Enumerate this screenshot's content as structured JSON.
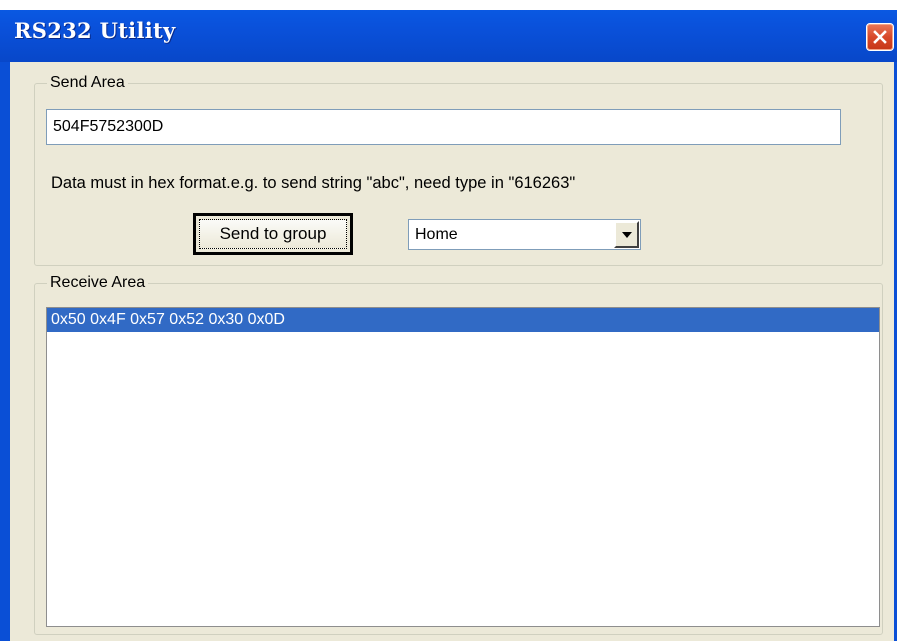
{
  "window": {
    "title": "RS232 Utility"
  },
  "send_area": {
    "legend": "Send Area",
    "hex_value": "504F5752300D",
    "hint": "Data must in hex format.e.g. to send string \"abc\", need type in \"616263\"",
    "send_button_label": "Send to group",
    "group_selected": "Home"
  },
  "receive_area": {
    "legend": "Receive Area",
    "rows": [
      {
        "text": "0x50 0x4F 0x57 0x52 0x30 0x0D",
        "selected": true
      }
    ]
  },
  "colors": {
    "titlebar": "#0a52dc",
    "close_button": "#d8492a",
    "dialog_face": "#ece9d8",
    "selection": "#316ac5"
  },
  "icons": {
    "close": "close-icon",
    "dropdown": "chevron-down-icon"
  }
}
